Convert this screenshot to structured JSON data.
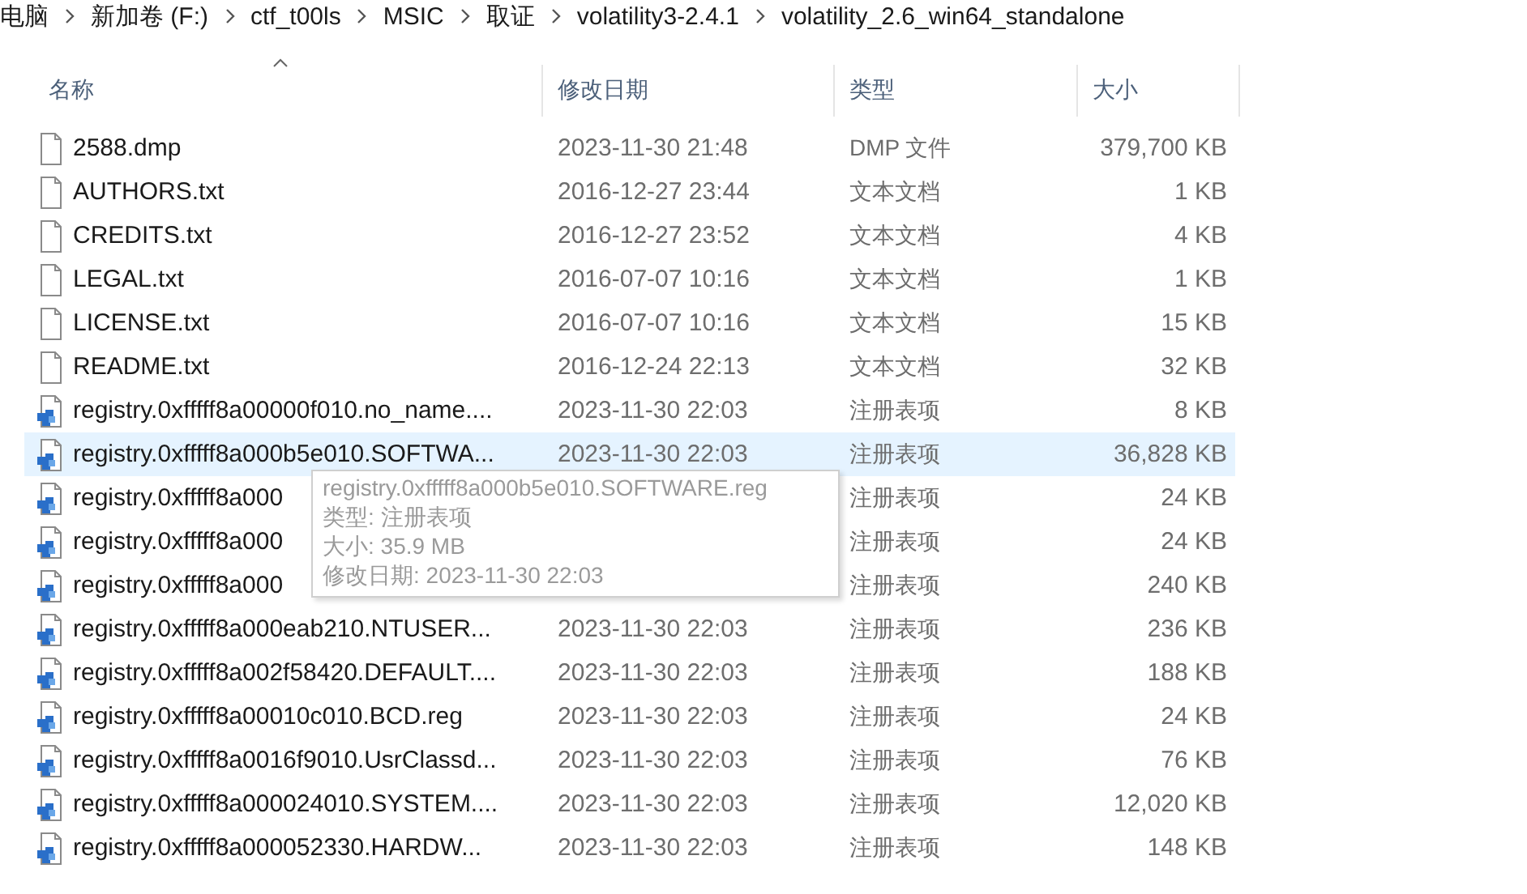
{
  "breadcrumb": [
    "电脑",
    "新加卷 (F:)",
    "ctf_t00ls",
    "MSIC",
    "取证",
    "volatility3-2.4.1",
    "volatility_2.6_win64_standalone"
  ],
  "table": {
    "columns": [
      {
        "label": "名称",
        "sorted": true
      },
      {
        "label": "修改日期",
        "sorted": false
      },
      {
        "label": "类型",
        "sorted": false
      },
      {
        "label": "大小",
        "sorted": false
      }
    ],
    "rows": [
      {
        "kind": "file",
        "name": "2588.dmp",
        "modified": "2023-11-30 21:48",
        "type": "DMP 文件",
        "size": "379,700 KB",
        "selected": false
      },
      {
        "kind": "file",
        "name": "AUTHORS.txt",
        "modified": "2016-12-27 23:44",
        "type": "文本文档",
        "size": "1 KB",
        "selected": false
      },
      {
        "kind": "file",
        "name": "CREDITS.txt",
        "modified": "2016-12-27 23:52",
        "type": "文本文档",
        "size": "4 KB",
        "selected": false
      },
      {
        "kind": "file",
        "name": "LEGAL.txt",
        "modified": "2016-07-07 10:16",
        "type": "文本文档",
        "size": "1 KB",
        "selected": false
      },
      {
        "kind": "file",
        "name": "LICENSE.txt",
        "modified": "2016-07-07 10:16",
        "type": "文本文档",
        "size": "15 KB",
        "selected": false
      },
      {
        "kind": "file",
        "name": "README.txt",
        "modified": "2016-12-24 22:13",
        "type": "文本文档",
        "size": "32 KB",
        "selected": false
      },
      {
        "kind": "registry",
        "name": "registry.0xfffff8a00000f010.no_name....",
        "modified": "2023-11-30 22:03",
        "type": "注册表项",
        "size": "8 KB",
        "selected": false
      },
      {
        "kind": "registry",
        "name": "registry.0xfffff8a000b5e010.SOFTWA...",
        "modified": "2023-11-30 22:03",
        "type": "注册表项",
        "size": "36,828 KB",
        "selected": true
      },
      {
        "kind": "registry",
        "name": "registry.0xfffff8a000",
        "type": "注册表项",
        "size": "24 KB",
        "selected": false
      },
      {
        "kind": "registry",
        "name": "registry.0xfffff8a000",
        "type": "注册表项",
        "size": "24 KB",
        "selected": false
      },
      {
        "kind": "registry",
        "name": "registry.0xfffff8a000",
        "type": "注册表项",
        "size": "240 KB",
        "selected": false
      },
      {
        "kind": "registry",
        "name": "registry.0xfffff8a000eab210.NTUSER...",
        "modified": "2023-11-30 22:03",
        "type": "注册表项",
        "size": "236 KB",
        "selected": false
      },
      {
        "kind": "registry",
        "name": "registry.0xfffff8a002f58420.DEFAULT....",
        "modified": "2023-11-30 22:03",
        "type": "注册表项",
        "size": "188 KB",
        "selected": false
      },
      {
        "kind": "registry",
        "name": "registry.0xfffff8a00010c010.BCD.reg",
        "modified": "2023-11-30 22:03",
        "type": "注册表项",
        "size": "24 KB",
        "selected": false
      },
      {
        "kind": "registry",
        "name": "registry.0xfffff8a0016f9010.UsrClassd...",
        "modified": "2023-11-30 22:03",
        "type": "注册表项",
        "size": "76 KB",
        "selected": false
      },
      {
        "kind": "registry",
        "name": "registry.0xfffff8a000024010.SYSTEM....",
        "modified": "2023-11-30 22:03",
        "type": "注册表项",
        "size": "12,020 KB",
        "selected": false
      },
      {
        "kind": "registry",
        "name": "registry.0xfffff8a000052330.HARDW...",
        "modified": "2023-11-30 22:03",
        "type": "注册表项",
        "size": "148 KB",
        "selected": false
      }
    ]
  },
  "tooltip": {
    "lines": [
      "registry.0xfffff8a000b5e010.SOFTWARE.reg",
      "类型: 注册表项",
      "大小: 35.9 MB",
      "修改日期: 2023-11-30 22:03"
    ]
  }
}
